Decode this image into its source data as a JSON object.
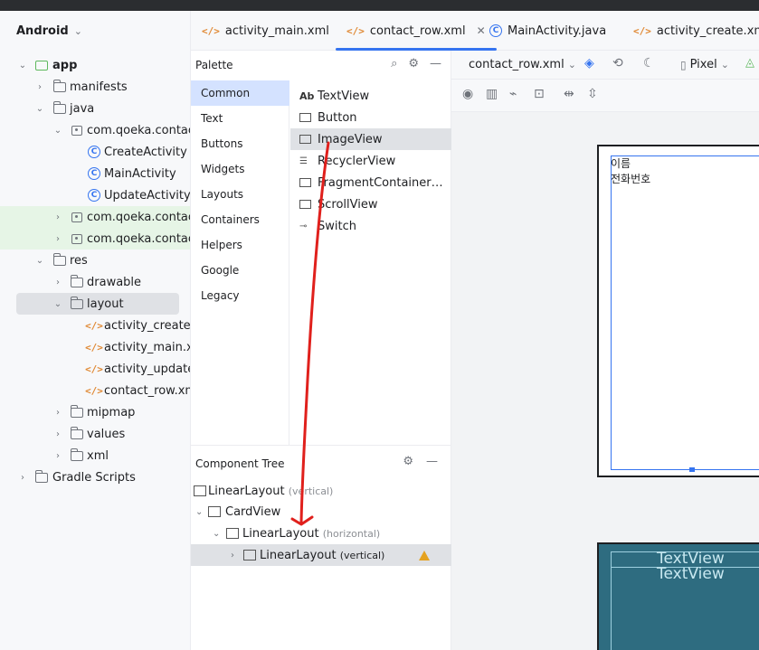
{
  "project": {
    "title": "Android",
    "items": [
      {
        "label": "app",
        "icon": "module-folder-icon",
        "arrow": "⌄"
      },
      {
        "label": "manifests",
        "icon": "folder-icon",
        "arrow": "›"
      },
      {
        "label": "java",
        "icon": "folder-icon",
        "arrow": "⌄"
      },
      {
        "label": "com.qoeka.contacta",
        "icon": "package-icon",
        "arrow": "⌄"
      },
      {
        "label": "CreateActivity",
        "icon": "class-icon"
      },
      {
        "label": "MainActivity",
        "icon": "class-icon"
      },
      {
        "label": "UpdateActivity",
        "icon": "class-icon"
      },
      {
        "label": "com.qoeka.contacta",
        "icon": "package-icon",
        "arrow": "›"
      },
      {
        "label": "com.qoeka.contacta",
        "icon": "package-icon",
        "arrow": "›"
      },
      {
        "label": "res",
        "icon": "folder-icon",
        "arrow": "⌄"
      },
      {
        "label": "drawable",
        "icon": "folder-icon",
        "arrow": "›"
      },
      {
        "label": "layout",
        "icon": "folder-icon",
        "arrow": "⌄"
      },
      {
        "label": "activity_create.xr",
        "icon": "xml-file-icon"
      },
      {
        "label": "activity_main.xm",
        "icon": "xml-file-icon"
      },
      {
        "label": "activity_update.x",
        "icon": "xml-file-icon"
      },
      {
        "label": "contact_row.xml",
        "icon": "xml-file-icon"
      },
      {
        "label": "mipmap",
        "icon": "folder-icon",
        "arrow": "›"
      },
      {
        "label": "values",
        "icon": "folder-icon",
        "arrow": "›"
      },
      {
        "label": "xml",
        "icon": "folder-icon",
        "arrow": "›"
      },
      {
        "label": "Gradle Scripts",
        "icon": "gradle-icon",
        "arrow": "›"
      }
    ]
  },
  "tabs": [
    {
      "label": "activity_main.xml"
    },
    {
      "label": "contact_row.xml",
      "close": "✕"
    },
    {
      "label": "MainActivity.java"
    },
    {
      "label": "activity_create.xml"
    }
  ],
  "palette": {
    "title": "Palette",
    "categories": [
      "Common",
      "Text",
      "Buttons",
      "Widgets",
      "Layouts",
      "Containers",
      "Helpers",
      "Google",
      "Legacy"
    ],
    "widgets": [
      "TextView",
      "Button",
      "ImageView",
      "RecyclerView",
      "FragmentContainer…",
      "ScrollView",
      "Switch"
    ],
    "textview_glyph": "Ab"
  },
  "component_tree": {
    "title": "Component Tree",
    "items": [
      {
        "label": "LinearLayout",
        "sub": "(vertical)"
      },
      {
        "label": "CardView",
        "sub": ""
      },
      {
        "label": "LinearLayout",
        "sub": "(horizontal)"
      },
      {
        "label": "LinearLayout",
        "sub": "(vertical)"
      }
    ]
  },
  "design": {
    "file_select": "contact_row.xml",
    "device": "Pixel",
    "preview_text_1": "이름",
    "preview_text_2": "전화번호",
    "blueprint_text_1": "TextView",
    "blueprint_text_2": "TextView"
  },
  "colors": {
    "accent": "#3574f0",
    "annotation": "#e0201c",
    "warning": "#e5a21f"
  }
}
